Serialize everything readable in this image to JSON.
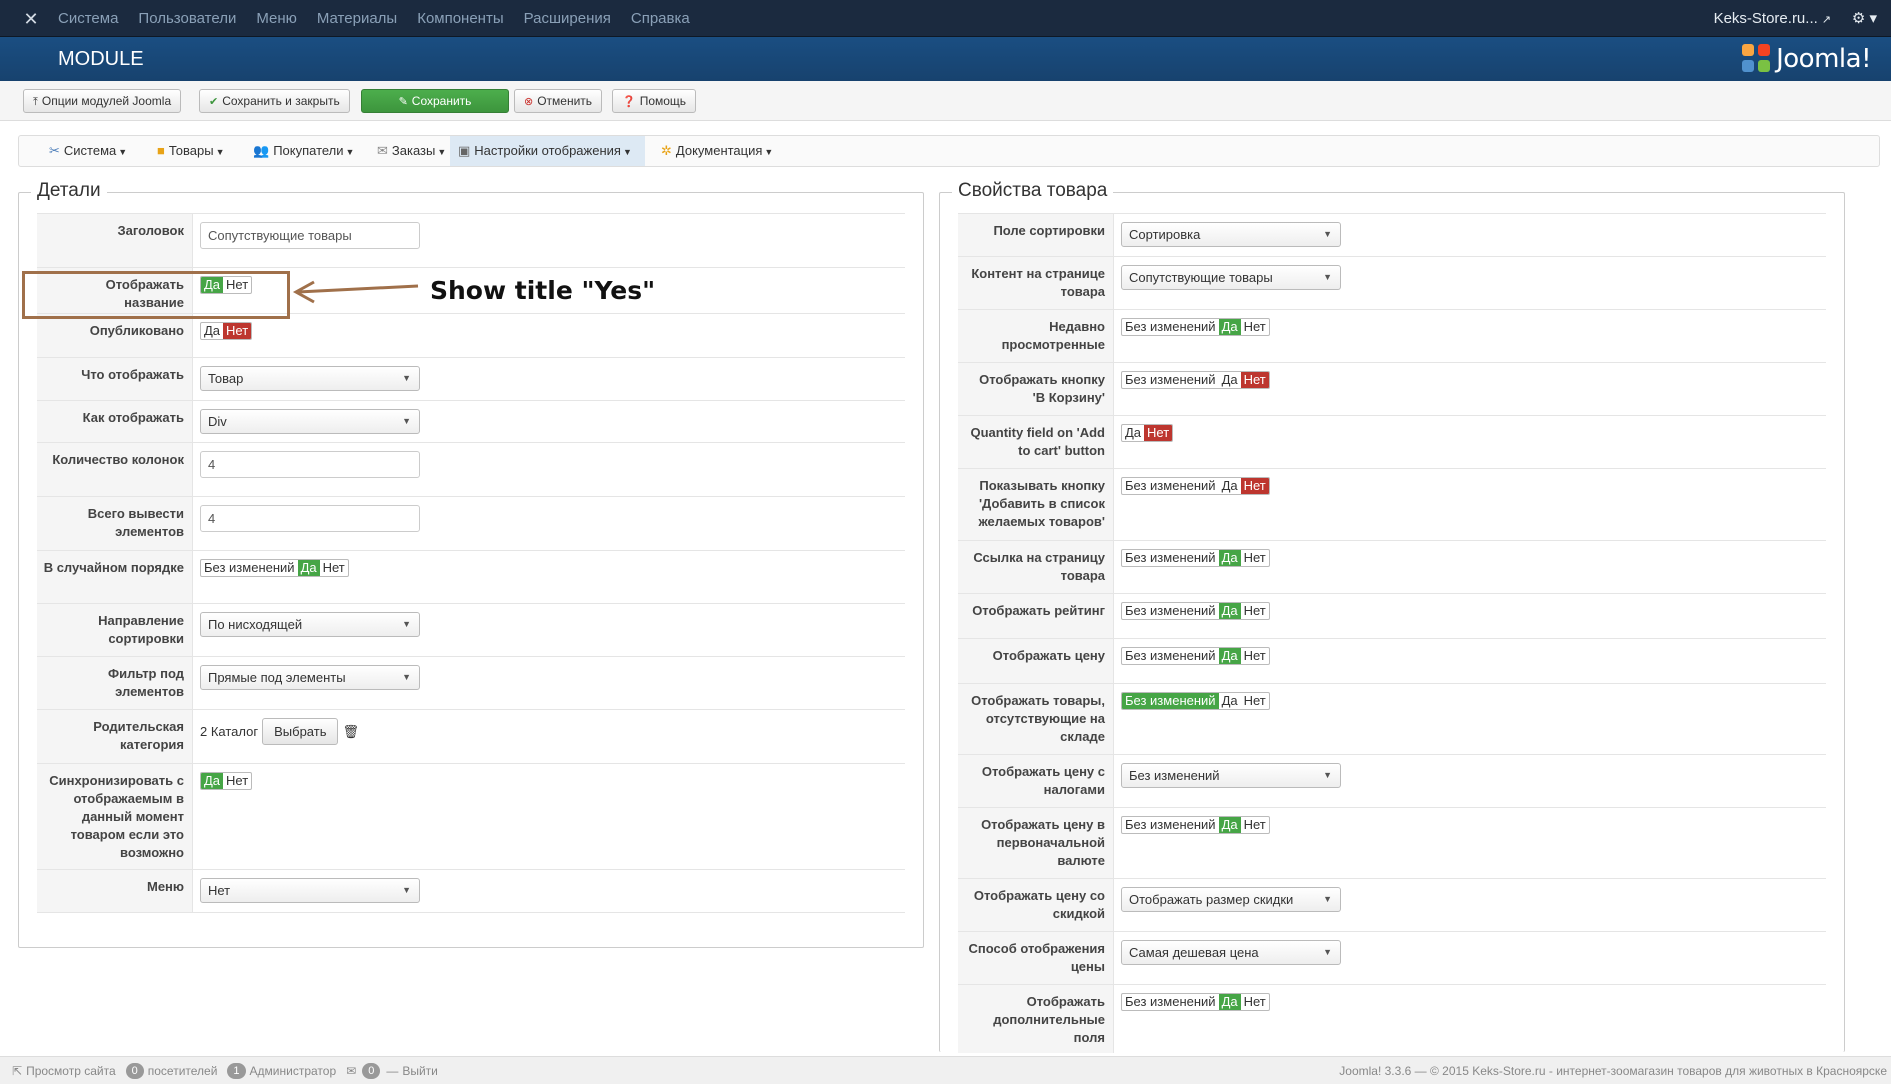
{
  "topbar": {
    "menu": [
      "Система",
      "Пользователи",
      "Меню",
      "Материалы",
      "Компоненты",
      "Расширения",
      "Справка"
    ],
    "site": "Keks-Store.ru..."
  },
  "header": {
    "title": "MODULE",
    "brand": "Joomla!"
  },
  "toolbar": {
    "options": "Опции модулей Joomla",
    "save_close": "Сохранить и закрыть",
    "save": "Сохранить",
    "cancel": "Отменить",
    "help": "Помощь"
  },
  "subnav": {
    "items": [
      "Система",
      "Товары",
      "Покупатели",
      "Заказы",
      "Настройки отображения",
      "Документация"
    ]
  },
  "details": {
    "legend": "Детали",
    "title_label": "Заголовок",
    "title_value": "Сопутствующие товары",
    "show_title": "Отображать название",
    "published": "Опубликовано",
    "what_show": "Что отображать",
    "what_show_value": "Товар",
    "how_show": "Как отображать",
    "how_show_value": "Div",
    "cols": "Количество колонок",
    "cols_value": "4",
    "total": "Всего вывести элементов",
    "total_value": "4",
    "random": "В случайном порядке",
    "sort_dir": "Направление сортировки",
    "sort_dir_value": "По нисходящей",
    "filter": "Фильтр под элементов",
    "filter_value": "Прямые под элементы",
    "parent": "Родительская категория",
    "parent_value": "2 Каталог",
    "choose": "Выбрать",
    "sync": "Синхронизировать с отображаемым в данный момент товаром если это возможно",
    "menu": "Меню",
    "menu_value": "Нет"
  },
  "props": {
    "legend": "Свойства товара",
    "sort_field": "Поле сортировки",
    "sort_field_value": "Сортировка",
    "content": "Контент на странице товара",
    "content_value": "Сопутствующие товары",
    "recent": "Недавно просмотренные",
    "cart_btn": "Отображать кнопку 'В Корзину'",
    "qty": "Quantity field on 'Add to cart' button",
    "wishlist": "Показывать кнопку 'Добавить в список желаемых товаров'",
    "link": "Ссылка на страницу товара",
    "rating": "Отображать рейтинг",
    "price": "Отображать цену",
    "out_stock": "Отображать товары, отсутствующие на складе",
    "price_tax": "Отображать цену с налогами",
    "price_orig": "Отображать цену в первоначальной валюте",
    "price_disc": "Отображать цену со скидкой",
    "price_disc_value": "Отображать размер скидки",
    "price_mode": "Способ отображения цены",
    "price_mode_value": "Самая дешевая цена",
    "price_tax_value": "Без изменений",
    "extra": "Отображать дополнительные поля"
  },
  "toggle": {
    "none": "Без изменений",
    "yes": "Да",
    "no": "Нет"
  },
  "annotation": "Show title \"Yes\"",
  "footer": {
    "view_site": "Просмотр сайта",
    "visitors_count": "0",
    "visitors": "посетителей",
    "admins_count": "1",
    "admins": "Администратор",
    "msgs_count": "0",
    "logout": "Выйти",
    "copyright": "Joomla! 3.3.6 — © 2015 Keks-Store.ru - интернет-зоомагазин товаров для животных в Красноярске"
  }
}
